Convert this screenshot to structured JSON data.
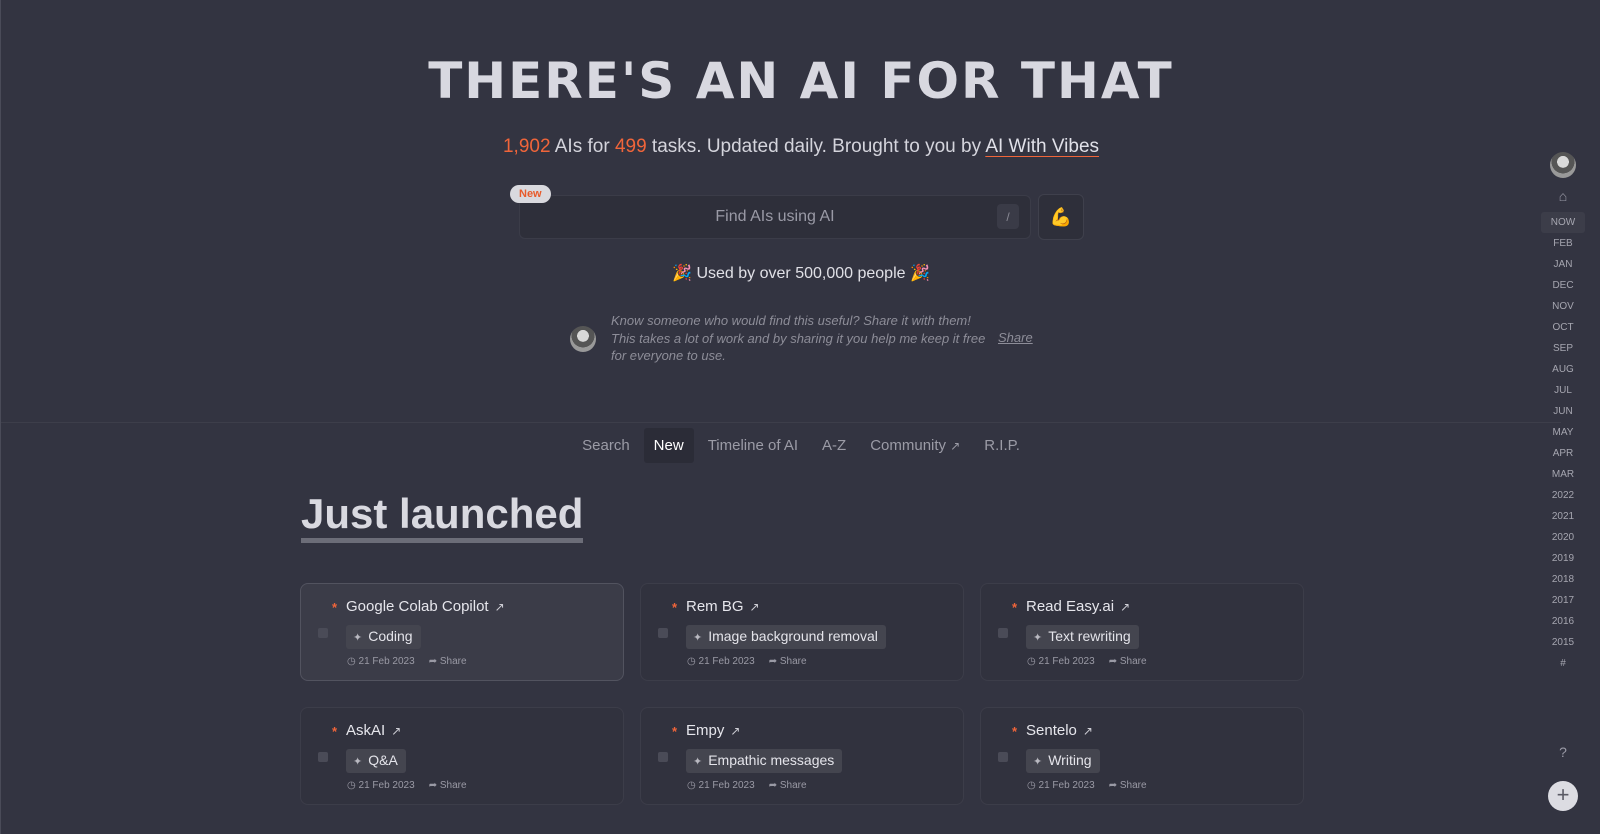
{
  "hero": {
    "title": "THERE'S AN AI FOR THAT",
    "ai_count": "1,902",
    "ais_for": "AIs for",
    "task_count": "499",
    "tagline": "tasks. Updated daily. Brought to you by",
    "brand_link": "AI With Vibes"
  },
  "search": {
    "badge": "New",
    "placeholder": "Find AIs using AI",
    "shortcut": "/",
    "action_icon": "muscle-icon"
  },
  "used_by": "🎉 Used by over 500,000 people 🎉",
  "share_note": {
    "text": "Know someone who would find this useful? Share it with them! This takes a lot of work and by sharing it you help me keep it free for everyone to use.",
    "link": "Share"
  },
  "tabs": [
    {
      "label": "Search"
    },
    {
      "label": "New",
      "active": true
    },
    {
      "label": "Timeline of AI"
    },
    {
      "label": "A-Z"
    },
    {
      "label": "Community",
      "external": true
    },
    {
      "label": "R.I.P."
    }
  ],
  "section_title": "Just launched",
  "cards": [
    {
      "name": "Google Colab Copilot",
      "tag": "Coding",
      "date": "21 Feb 2023",
      "share": "Share"
    },
    {
      "name": "Rem BG",
      "tag": "Image background removal",
      "date": "21 Feb 2023",
      "share": "Share"
    },
    {
      "name": "Read Easy.ai",
      "tag": "Text rewriting",
      "date": "21 Feb 2023",
      "share": "Share"
    },
    {
      "name": "AskAI",
      "tag": "Q&A",
      "date": "21 Feb 2023",
      "share": "Share"
    },
    {
      "name": "Empy",
      "tag": "Empathic messages",
      "date": "21 Feb 2023",
      "share": "Share"
    },
    {
      "name": "Sentelo",
      "tag": "Writing",
      "date": "21 Feb 2023",
      "share": "Share"
    }
  ],
  "sidebar": {
    "items": [
      "NOW",
      "FEB",
      "JAN",
      "DEC",
      "NOV",
      "OCT",
      "SEP",
      "AUG",
      "JUL",
      "JUN",
      "MAY",
      "APR",
      "MAR",
      "2022",
      "2021",
      "2020",
      "2019",
      "2018",
      "2017",
      "2016",
      "2015",
      "#"
    ],
    "active": "NOW",
    "help": "?",
    "add": "+"
  },
  "colors": {
    "accent": "#f0653a",
    "background": "#333441"
  }
}
